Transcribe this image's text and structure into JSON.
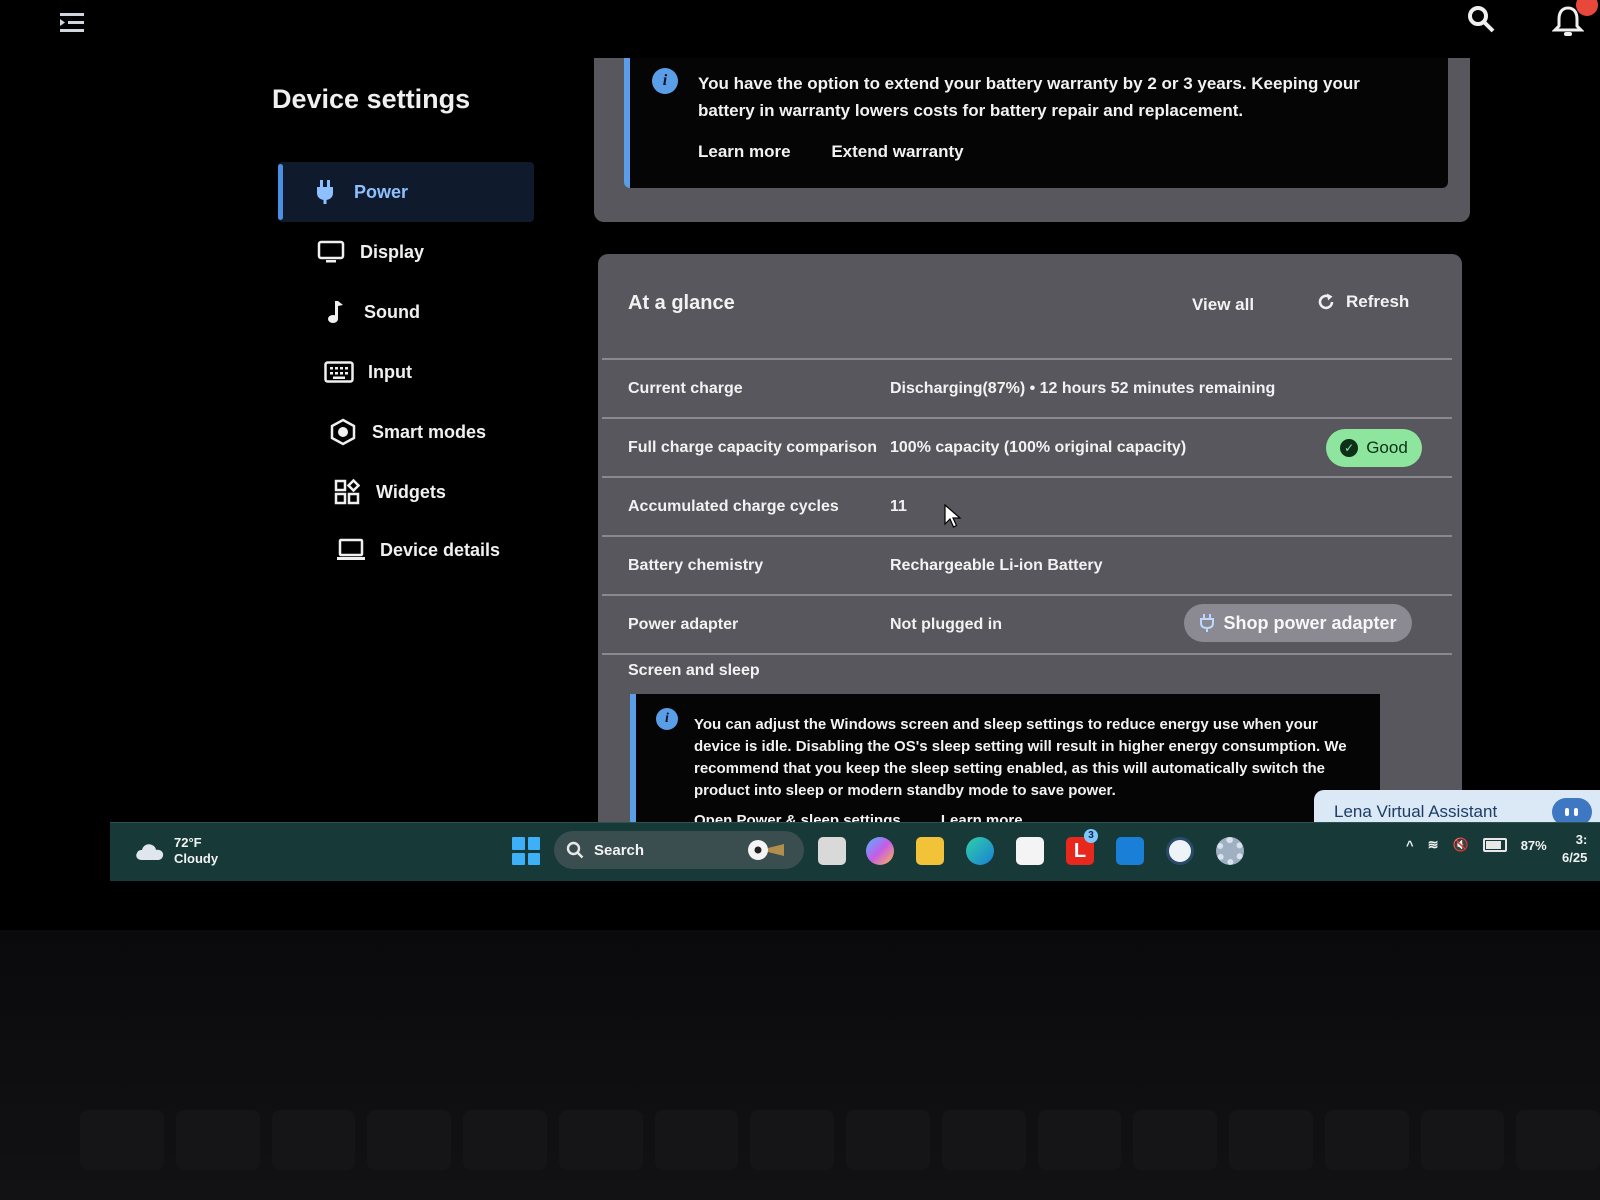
{
  "topbar": {
    "menu_icon": "menu-icon",
    "search_icon": "search-icon",
    "bell_icon": "bell-icon"
  },
  "sidebar": {
    "title": "Device settings",
    "items": [
      {
        "label": "Power",
        "icon": "plug-icon",
        "active": true
      },
      {
        "label": "Display",
        "icon": "monitor-icon"
      },
      {
        "label": "Sound",
        "icon": "music-note-icon"
      },
      {
        "label": "Input",
        "icon": "keyboard-icon"
      },
      {
        "label": "Smart modes",
        "icon": "hexagon-icon"
      },
      {
        "label": "Widgets",
        "icon": "widgets-icon"
      },
      {
        "label": "Device details",
        "icon": "laptop-icon"
      }
    ]
  },
  "warranty": {
    "text": "You have the option to extend your battery warranty by 2 or 3 years. Keeping your battery in warranty lowers costs for battery repair and replacement.",
    "learn_more": "Learn more",
    "extend": "Extend warranty"
  },
  "glance": {
    "title": "At a glance",
    "view_all": "View all",
    "refresh": "Refresh",
    "rows": [
      {
        "label": "Current charge",
        "value": "Discharging(87%)  •  12 hours 52 minutes remaining"
      },
      {
        "label": "Full charge capacity comparison",
        "value": "100% capacity (100% original capacity)",
        "badge": "Good"
      },
      {
        "label": "Accumulated charge cycles",
        "value": "11"
      },
      {
        "label": "Battery chemistry",
        "value": "Rechargeable Li-ion Battery"
      },
      {
        "label": "Power adapter",
        "value": "Not plugged in",
        "button": "Shop power adapter"
      }
    ],
    "screen_sleep_title": "Screen and sleep",
    "screen_sleep_text": "You can adjust the Windows screen and sleep settings to reduce energy use when your device is idle. Disabling the OS's sleep setting will result in higher energy consumption. We recommend that you keep the sleep setting enabled, as this will automatically switch the product into sleep or modern standby mode to save power.",
    "open_power_link": "Open Power & sleep settings",
    "learn_more": "Learn more"
  },
  "assistant": {
    "label": "Lena Virtual Assistant"
  },
  "taskbar": {
    "weather_temp": "72°F",
    "weather_desc": "Cloudy",
    "search_label": "Search",
    "battery_percent": "87%",
    "clock_time": "3:",
    "clock_date": "6/25",
    "app_badge": "3"
  },
  "colors": {
    "accent": "#4a90e2",
    "good_badge": "#8ee69e",
    "taskbar": "#173a39",
    "card": "#58575e"
  }
}
